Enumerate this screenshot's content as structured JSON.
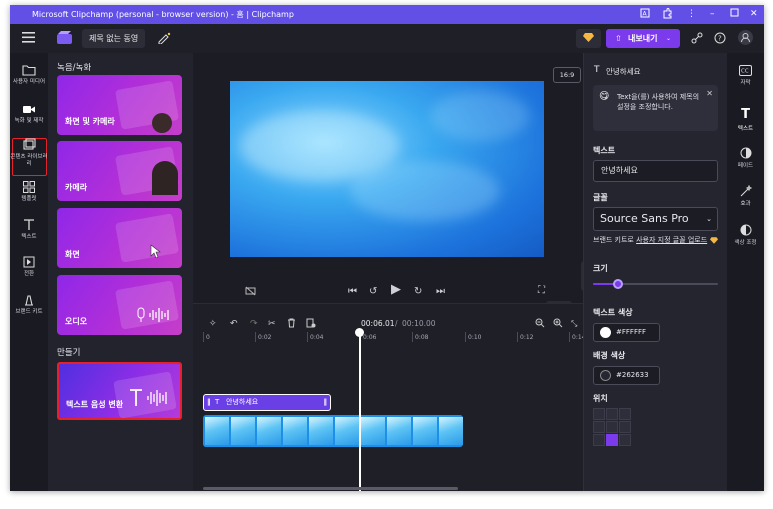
{
  "window": {
    "title": "Microsoft Clipchamp (personal - browser version) - 홈 | Clipchamp"
  },
  "appbar": {
    "project_title": "제목 없는 동영",
    "export_label": "내보내기",
    "aspect_ratio": "16:9"
  },
  "left_nav": {
    "items": [
      {
        "label": "사용자 미디어",
        "icon": "folder-icon"
      },
      {
        "label": "녹화 및 제작",
        "icon": "video-camera-icon"
      },
      {
        "label": "콘텐츠 라이브러리",
        "icon": "library-icon"
      },
      {
        "label": "템플릿",
        "icon": "template-icon"
      },
      {
        "label": "텍스트",
        "icon": "text-icon"
      },
      {
        "label": "전환",
        "icon": "transition-icon"
      },
      {
        "label": "브랜드 키트",
        "icon": "brand-kit-icon"
      }
    ]
  },
  "panel": {
    "section_record": "녹음/녹화",
    "cards": [
      {
        "label": "화면 및 카메라"
      },
      {
        "label": "카메라"
      },
      {
        "label": "화면"
      },
      {
        "label": "오디오"
      }
    ],
    "section_create": "만들기",
    "tts_label": "텍스트 음성 변환"
  },
  "timeline": {
    "current_time": "00:06.01",
    "total_time": "00:10.00",
    "ticks": [
      "0",
      "0:02",
      "0:04",
      "0:06",
      "0:08",
      "0:10",
      "0:12",
      "0:14"
    ],
    "text_clip_label": "안녕하세요"
  },
  "props": {
    "header": "안녕하세요",
    "tip_text": "Text을(를) 사용하여 제목의 설정을 조정합니다.",
    "text_label": "텍스트",
    "text_value": "안녕하세요",
    "font_label": "글꼴",
    "font_value": "Source Sans Pro",
    "brand_kit_prefix": "브랜드 키트로 ",
    "brand_kit_link": "사용자 지정 글꼴 업로드",
    "size_label": "크기",
    "size_fraction": 0.2,
    "text_color_label": "텍스트 색상",
    "text_color_value": "#FFFFFF",
    "bg_color_label": "배경 색상",
    "bg_color_value": "#262633",
    "position_label": "위치"
  },
  "right_nav": {
    "items": [
      {
        "label": "자막",
        "icon": "captions-icon"
      },
      {
        "label": "텍스트",
        "icon": "text-icon"
      },
      {
        "label": "페이드",
        "icon": "fade-icon"
      },
      {
        "label": "효과",
        "icon": "effects-icon"
      },
      {
        "label": "색상 조정",
        "icon": "color-adjust-icon"
      }
    ]
  },
  "colors": {
    "accent": "#7c3aed",
    "titlebar": "#6250e6",
    "highlight": "#e8202b"
  }
}
